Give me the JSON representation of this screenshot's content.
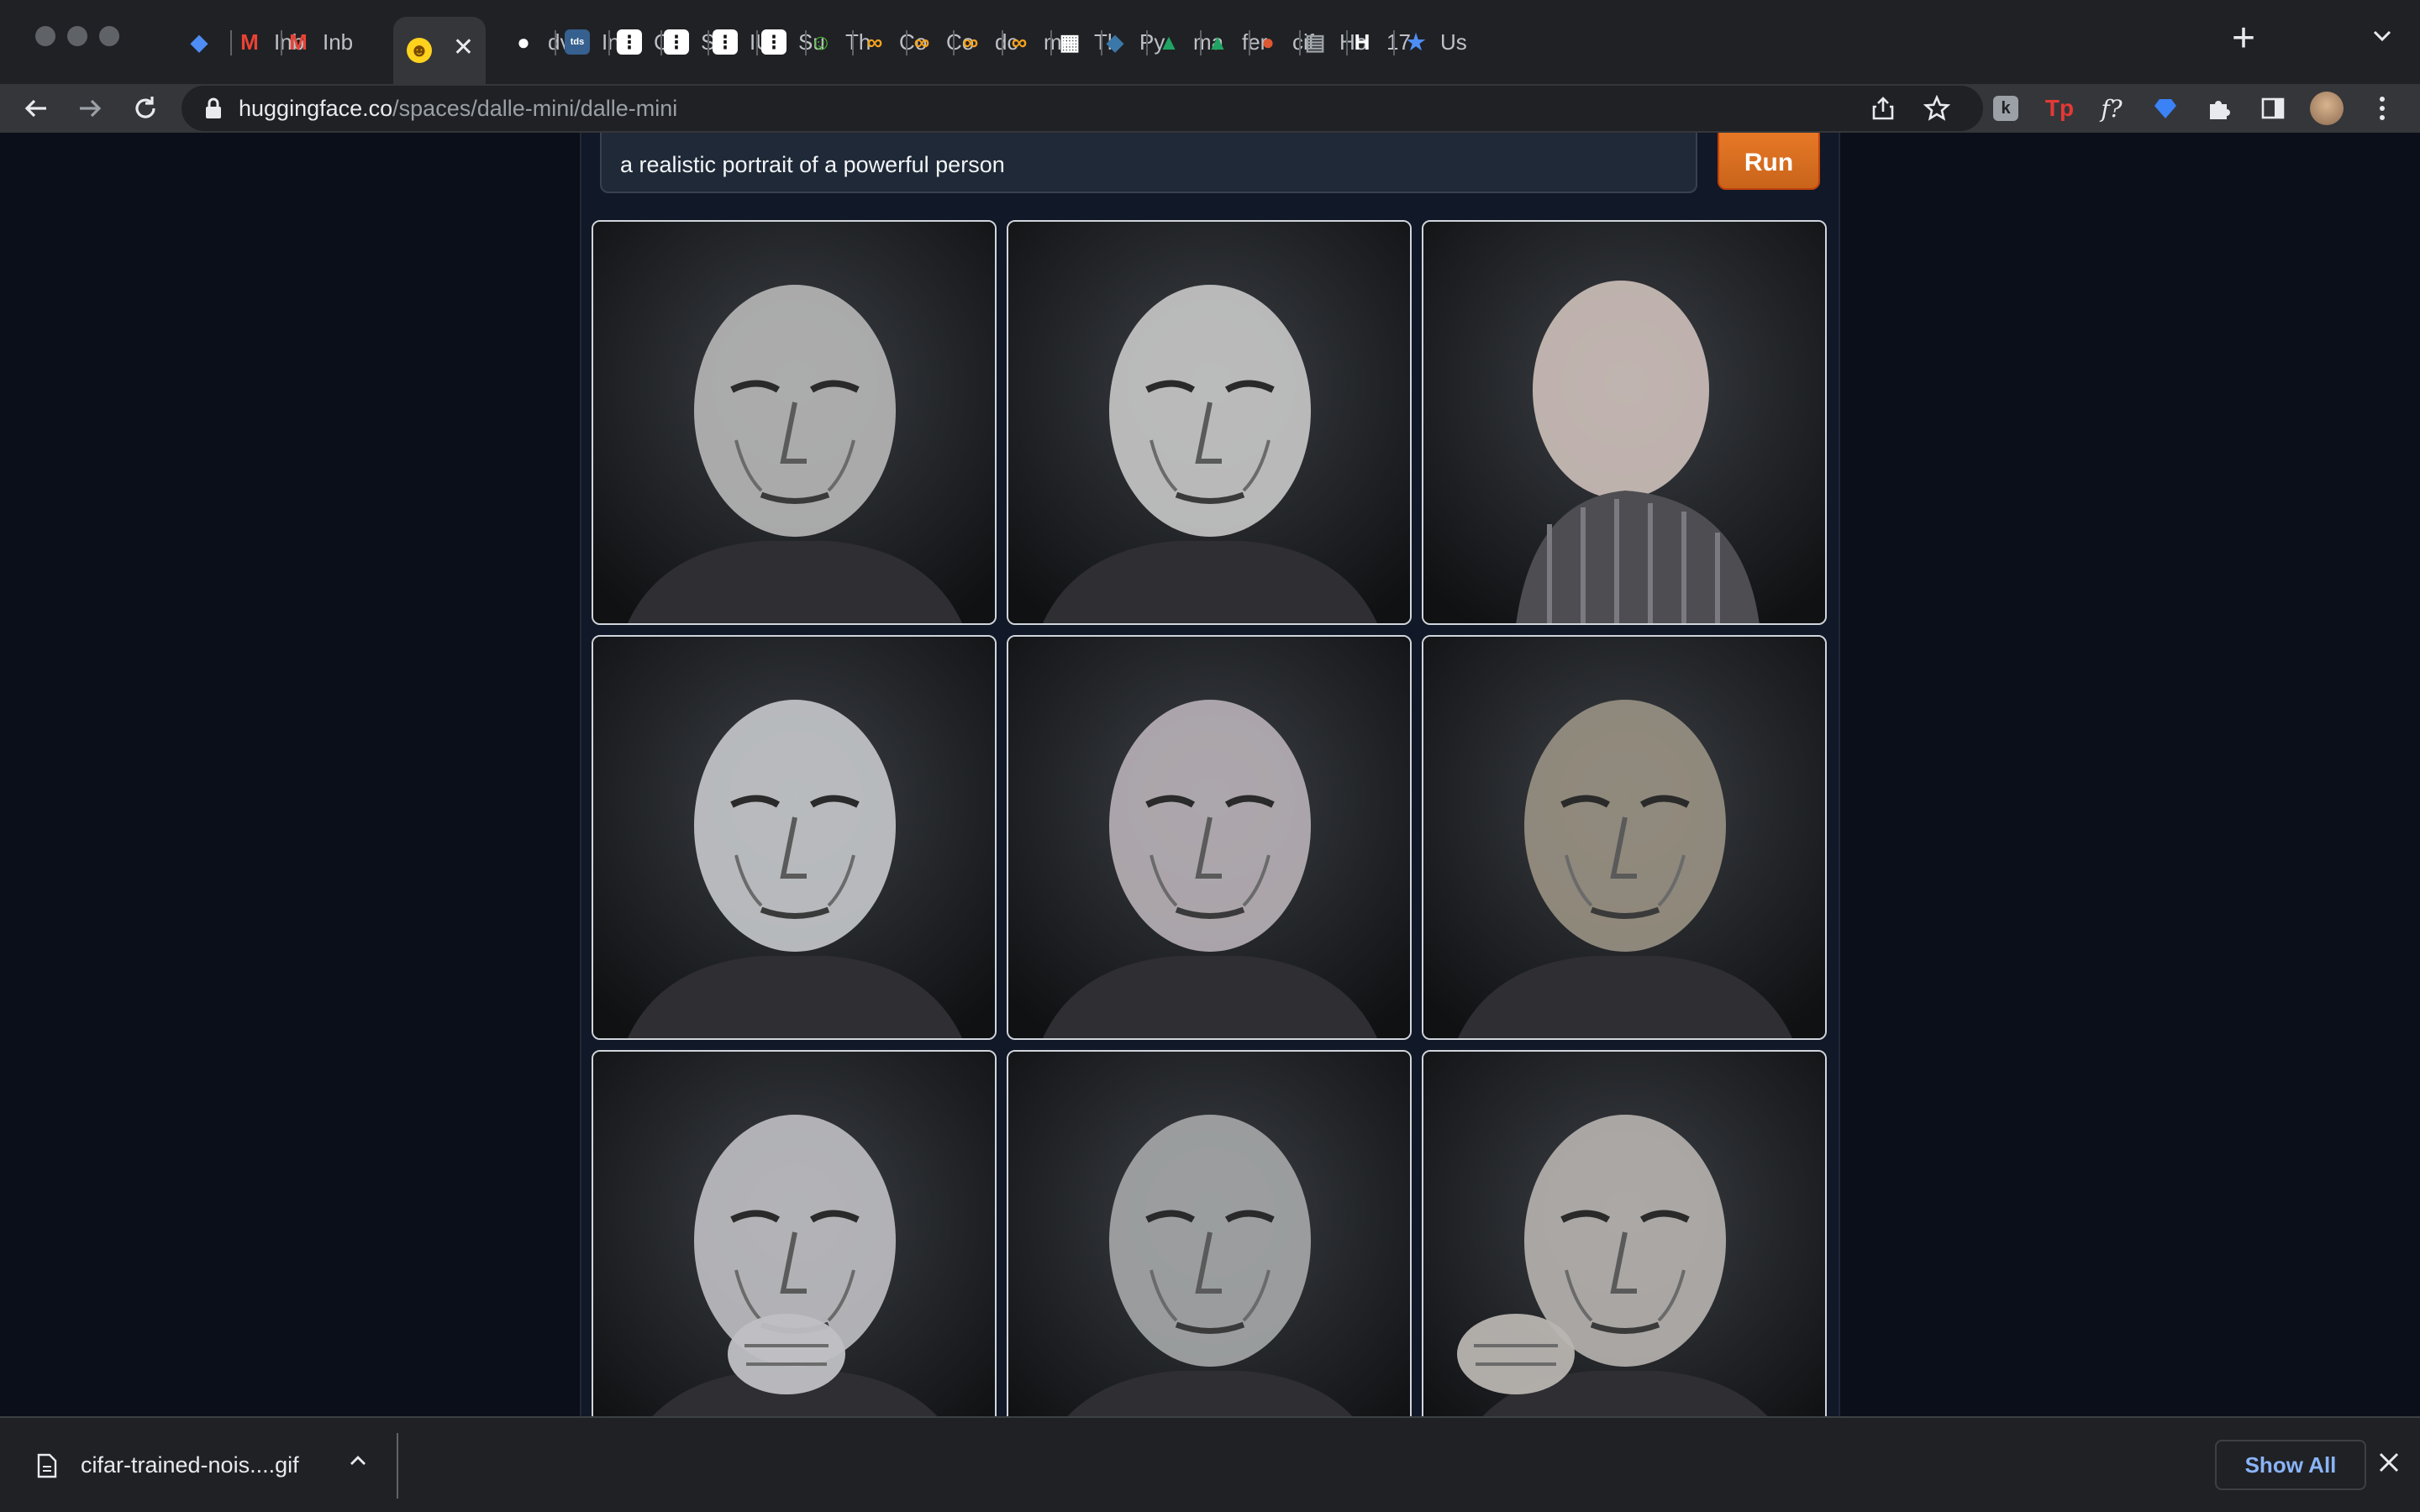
{
  "browser": {
    "tabs": [
      {
        "label": "",
        "icon": "gem-icon",
        "color": "#4e8df5"
      },
      {
        "label": "Inbox",
        "icon": "gmail-icon",
        "color": "#ea4335"
      },
      {
        "label": "Inbox",
        "icon": "gmail-icon",
        "color": "#ea4335"
      },
      {
        "label": "",
        "icon": "hugging-face-icon",
        "color": "#ffd21e",
        "active": true
      },
      {
        "label": "dv",
        "icon": "github-icon",
        "color": "#ffffff"
      },
      {
        "label": "Int",
        "icon": "tds-icon",
        "color": "#35608f"
      },
      {
        "label": "Co",
        "icon": "dots-icon",
        "color": "#111111"
      },
      {
        "label": "Su",
        "icon": "dots-icon",
        "color": "#111111"
      },
      {
        "label": "IUC",
        "icon": "dots-icon",
        "color": "#111111"
      },
      {
        "label": "Su",
        "icon": "dots-icon",
        "color": "#111111"
      },
      {
        "label": "Th",
        "icon": "smiley-icon",
        "color": "#42b72a"
      },
      {
        "label": "Co",
        "icon": "infinity-icon",
        "color": "#f6a21e"
      },
      {
        "label": "Co",
        "icon": "infinity-icon",
        "color": "#f6a21e"
      },
      {
        "label": "dc",
        "icon": "infinity-icon",
        "color": "#f6a21e"
      },
      {
        "label": "me",
        "icon": "infinity-icon",
        "color": "#f6a21e"
      },
      {
        "label": "Th",
        "icon": "grid-icon",
        "color": "#ffffff"
      },
      {
        "label": "Py",
        "icon": "python-icon",
        "color": "#3b77a8"
      },
      {
        "label": "ma",
        "icon": "drive-icon",
        "color": "#1fa463"
      },
      {
        "label": "fer",
        "icon": "drive-icon",
        "color": "#1fa463"
      },
      {
        "label": "cif",
        "icon": "duckduckgo-icon",
        "color": "#de5833"
      },
      {
        "label": "Ho",
        "icon": "doc-icon",
        "color": "#9aa0a6"
      },
      {
        "label": "17",
        "icon": "hp-icon",
        "color": "#ffffff"
      },
      {
        "label": "Us",
        "icon": "star-icon",
        "color": "#4e8df5"
      }
    ],
    "url_domain": "huggingface.co",
    "url_path": "/spaces/dalle-mini/dalle-mini",
    "extensions": [
      "k-icon",
      "tp-icon",
      "f-icon",
      "gem-icon",
      "puzzle-icon",
      "sidepanel-icon"
    ],
    "tp_label": "Tp",
    "f_label": "f?",
    "k_label": "k"
  },
  "app": {
    "prompt": "a realistic portrait of a powerful person",
    "run_label": "Run",
    "accent": "#e8731f",
    "images": [
      {
        "name": "generated-portrait-1",
        "tone": "#b8b8b8",
        "pose": "front"
      },
      {
        "name": "generated-portrait-2",
        "tone": "#c9c9c9",
        "pose": "front"
      },
      {
        "name": "generated-portrait-3",
        "tone": "#d8c9c3",
        "pose": "profile"
      },
      {
        "name": "generated-portrait-4",
        "tone": "#c6c9cc",
        "pose": "front"
      },
      {
        "name": "generated-portrait-5",
        "tone": "#b9b2b8",
        "pose": "front"
      },
      {
        "name": "generated-portrait-6",
        "tone": "#9a9284",
        "pose": "front"
      },
      {
        "name": "generated-portrait-7",
        "tone": "#c0c0c4",
        "pose": "hand"
      },
      {
        "name": "generated-portrait-8",
        "tone": "#a6a8aa",
        "pose": "front"
      },
      {
        "name": "generated-portrait-9",
        "tone": "#b8b4b0",
        "pose": "hand"
      }
    ]
  },
  "downloads": {
    "filename": "cifar-trained-nois....gif",
    "show_all_label": "Show All"
  }
}
